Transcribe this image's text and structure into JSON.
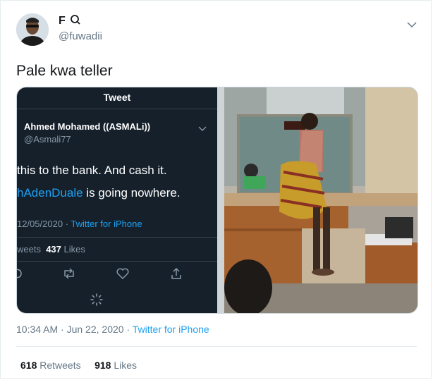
{
  "user": {
    "display_name": "F",
    "handle": "@fuwadii"
  },
  "tweet": {
    "text": "Pale kwa teller",
    "time": "10:34 AM · Jun 22, 2020",
    "separator": "·",
    "source": "Twitter for iPhone"
  },
  "embedded": {
    "header": "Tweet",
    "name": "Ahmed Mohamed ((ASMALi))",
    "handle": "@Asmali77",
    "line1": "this to the bank. And cash it.",
    "line2_mention": "hAdenDuale",
    "line2_rest": " is going nowhere.",
    "date": "12/05/2020",
    "sep": " · ",
    "source": "Twitter for iPhone",
    "retweets_label": "weets",
    "likes_count": "437",
    "likes_label": "Likes"
  },
  "stats": {
    "retweets_count": "618",
    "retweets_label": "Retweets",
    "likes_count": "918",
    "likes_label": "Likes"
  },
  "colors": {
    "accent": "#1da1f2",
    "dark_bg": "#15202b",
    "muted": "#657786"
  }
}
